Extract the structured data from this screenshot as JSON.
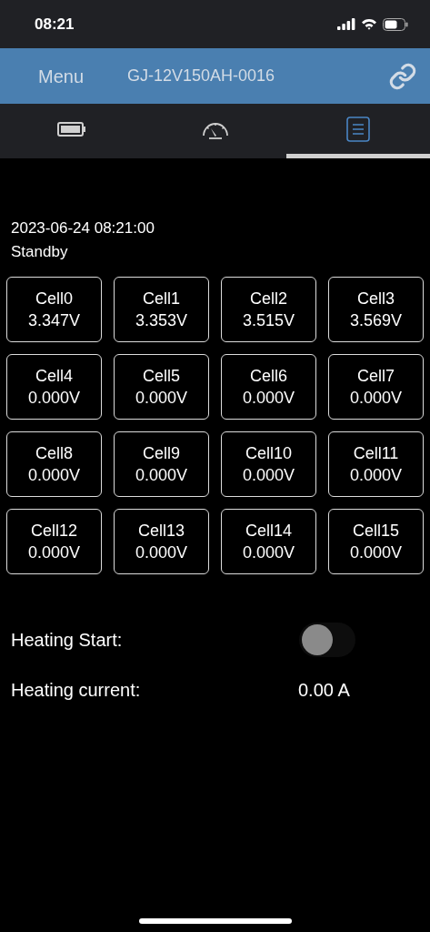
{
  "status_bar": {
    "time": "08:21"
  },
  "header": {
    "menu": "Menu",
    "title": "GJ-12V150AH-0016"
  },
  "tabs": [
    {
      "kind": "battery",
      "selected": false
    },
    {
      "kind": "gauge",
      "selected": false
    },
    {
      "kind": "list",
      "selected": true
    }
  ],
  "timestamp": "2023-06-24 08:21:00",
  "state": "Standby",
  "cells": [
    {
      "name": "Cell0",
      "voltage": "3.347V"
    },
    {
      "name": "Cell1",
      "voltage": "3.353V"
    },
    {
      "name": "Cell2",
      "voltage": "3.515V"
    },
    {
      "name": "Cell3",
      "voltage": "3.569V"
    },
    {
      "name": "Cell4",
      "voltage": "0.000V"
    },
    {
      "name": "Cell5",
      "voltage": "0.000V"
    },
    {
      "name": "Cell6",
      "voltage": "0.000V"
    },
    {
      "name": "Cell7",
      "voltage": "0.000V"
    },
    {
      "name": "Cell8",
      "voltage": "0.000V"
    },
    {
      "name": "Cell9",
      "voltage": "0.000V"
    },
    {
      "name": "Cell10",
      "voltage": "0.000V"
    },
    {
      "name": "Cell11",
      "voltage": "0.000V"
    },
    {
      "name": "Cell12",
      "voltage": "0.000V"
    },
    {
      "name": "Cell13",
      "voltage": "0.000V"
    },
    {
      "name": "Cell14",
      "voltage": "0.000V"
    },
    {
      "name": "Cell15",
      "voltage": "0.000V"
    }
  ],
  "heating_start": {
    "label": "Heating Start:",
    "on": false
  },
  "heating_current": {
    "label": "Heating current:",
    "value": "0.00 A"
  }
}
